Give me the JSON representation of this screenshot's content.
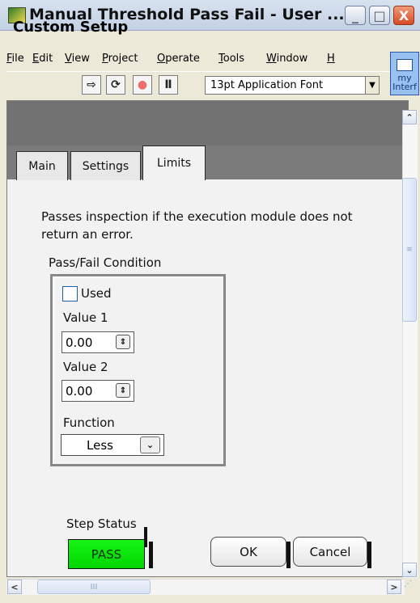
{
  "window": {
    "title": "Manual Threshold Pass Fail - User ...",
    "min_symbol": "_",
    "max_symbol": "□",
    "close_symbol": "X"
  },
  "menu": {
    "items": [
      {
        "label": "File",
        "underline": "F",
        "rest": "ile"
      },
      {
        "label": "Edit",
        "underline": "E",
        "rest": "dit"
      },
      {
        "label": "View",
        "underline": "V",
        "rest": "iew"
      },
      {
        "label": "Project",
        "underline": "P",
        "rest": "roject"
      },
      {
        "label": "Operate",
        "underline": "O",
        "rest": "perate"
      },
      {
        "label": "Tools",
        "underline": "T",
        "rest": "ools"
      },
      {
        "label": "Window",
        "underline": "W",
        "rest": "indow"
      },
      {
        "label": "H",
        "underline": "H",
        "rest": ""
      }
    ]
  },
  "toolbar": {
    "run_icon": "⇨",
    "continuous_run_icon": "⟳",
    "abort_icon": "●",
    "pause_icon": "Ⅱ",
    "font_selector": "13pt Application Font",
    "dropdown_icon": "▼",
    "project_icon_line1": "my",
    "project_icon_line2": "Interf"
  },
  "header": {
    "title": "Custom Setup"
  },
  "tabs": [
    {
      "label": "Main"
    },
    {
      "label": "Settings"
    },
    {
      "label": "Limits"
    }
  ],
  "limits": {
    "description": "Passes inspection if the execution module does not return an error.",
    "pass_fail_label": "Pass/Fail Condition",
    "used_label": "Used",
    "used_checked": false,
    "value1_label": "Value 1",
    "value1": "0.00",
    "value2_label": "Value 2",
    "value2": "0.00",
    "function_label": "Function",
    "function_value": "Less",
    "spinner_icon": "⇕",
    "select_icon": "⌄"
  },
  "status": {
    "label": "Step Status",
    "value": "PASS",
    "color": "#16f516"
  },
  "buttons": {
    "ok": "OK",
    "cancel": "Cancel"
  },
  "scrollbars": {
    "up_icon": "⌃",
    "down_icon": "⌄",
    "left_icon": "<",
    "right_icon": ">",
    "thumb_icon": "≡",
    "h_thumb_icon": "III"
  }
}
